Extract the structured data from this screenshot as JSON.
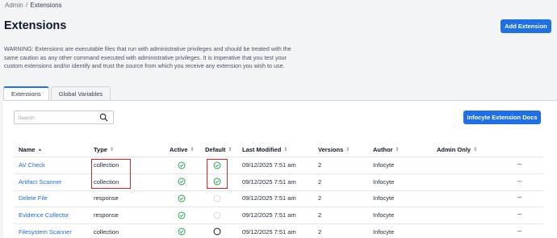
{
  "breadcrumb": {
    "parent": "Admin",
    "separator": "/",
    "current": "Extensions"
  },
  "page_title": "Extensions",
  "add_button": "Add Extension",
  "warning": "WARNING: Extensions are executable files that run with administrative privileges and should be treated with the same caution as any other command executed with administrative privileges. It is imperative that you test your custom extensions and/or identify and trust the source from which you receive any extension you wish to use.",
  "tabs": [
    {
      "label": "Extensions",
      "active": true
    },
    {
      "label": "Global Variables",
      "active": false
    }
  ],
  "search": {
    "placeholder": "Search",
    "value": ""
  },
  "docs_button": "Infocyte Extension Docs",
  "columns": {
    "name": "Name",
    "type": "Type",
    "active": "Active",
    "default": "Default",
    "last_modified": "Last Modified",
    "versions": "Versions",
    "author": "Author",
    "admin_only": "Admin Only"
  },
  "rows": [
    {
      "name": "AV Check",
      "type": "collection",
      "active": "check",
      "default": "check",
      "last_modified": "09/12/2025 7:51 am",
      "versions": "2",
      "author": "Infocyte",
      "actions": "···"
    },
    {
      "name": "Artifact Scanner",
      "type": "collection",
      "active": "check",
      "default": "check",
      "last_modified": "09/12/2025 7:51 am",
      "versions": "2",
      "author": "Infocyte",
      "actions": "···"
    },
    {
      "name": "Delete File",
      "type": "response",
      "active": "check",
      "default": "empty-faint",
      "last_modified": "09/12/2025 7:51 am",
      "versions": "2",
      "author": "Infocyte",
      "actions": "···"
    },
    {
      "name": "Evidence Collector",
      "type": "response",
      "active": "check",
      "default": "empty-faint",
      "last_modified": "09/12/2025 7:51 am",
      "versions": "2",
      "author": "Infocyte",
      "actions": "···"
    },
    {
      "name": "Filesystem Scanner",
      "type": "collection",
      "active": "check",
      "default": "empty",
      "last_modified": "09/12/2025 7:51 am",
      "versions": "2",
      "author": "Infocyte",
      "actions": "···"
    }
  ],
  "colors": {
    "accent": "#1f6fe5",
    "success": "#22a34a",
    "highlight": "#e02424"
  }
}
